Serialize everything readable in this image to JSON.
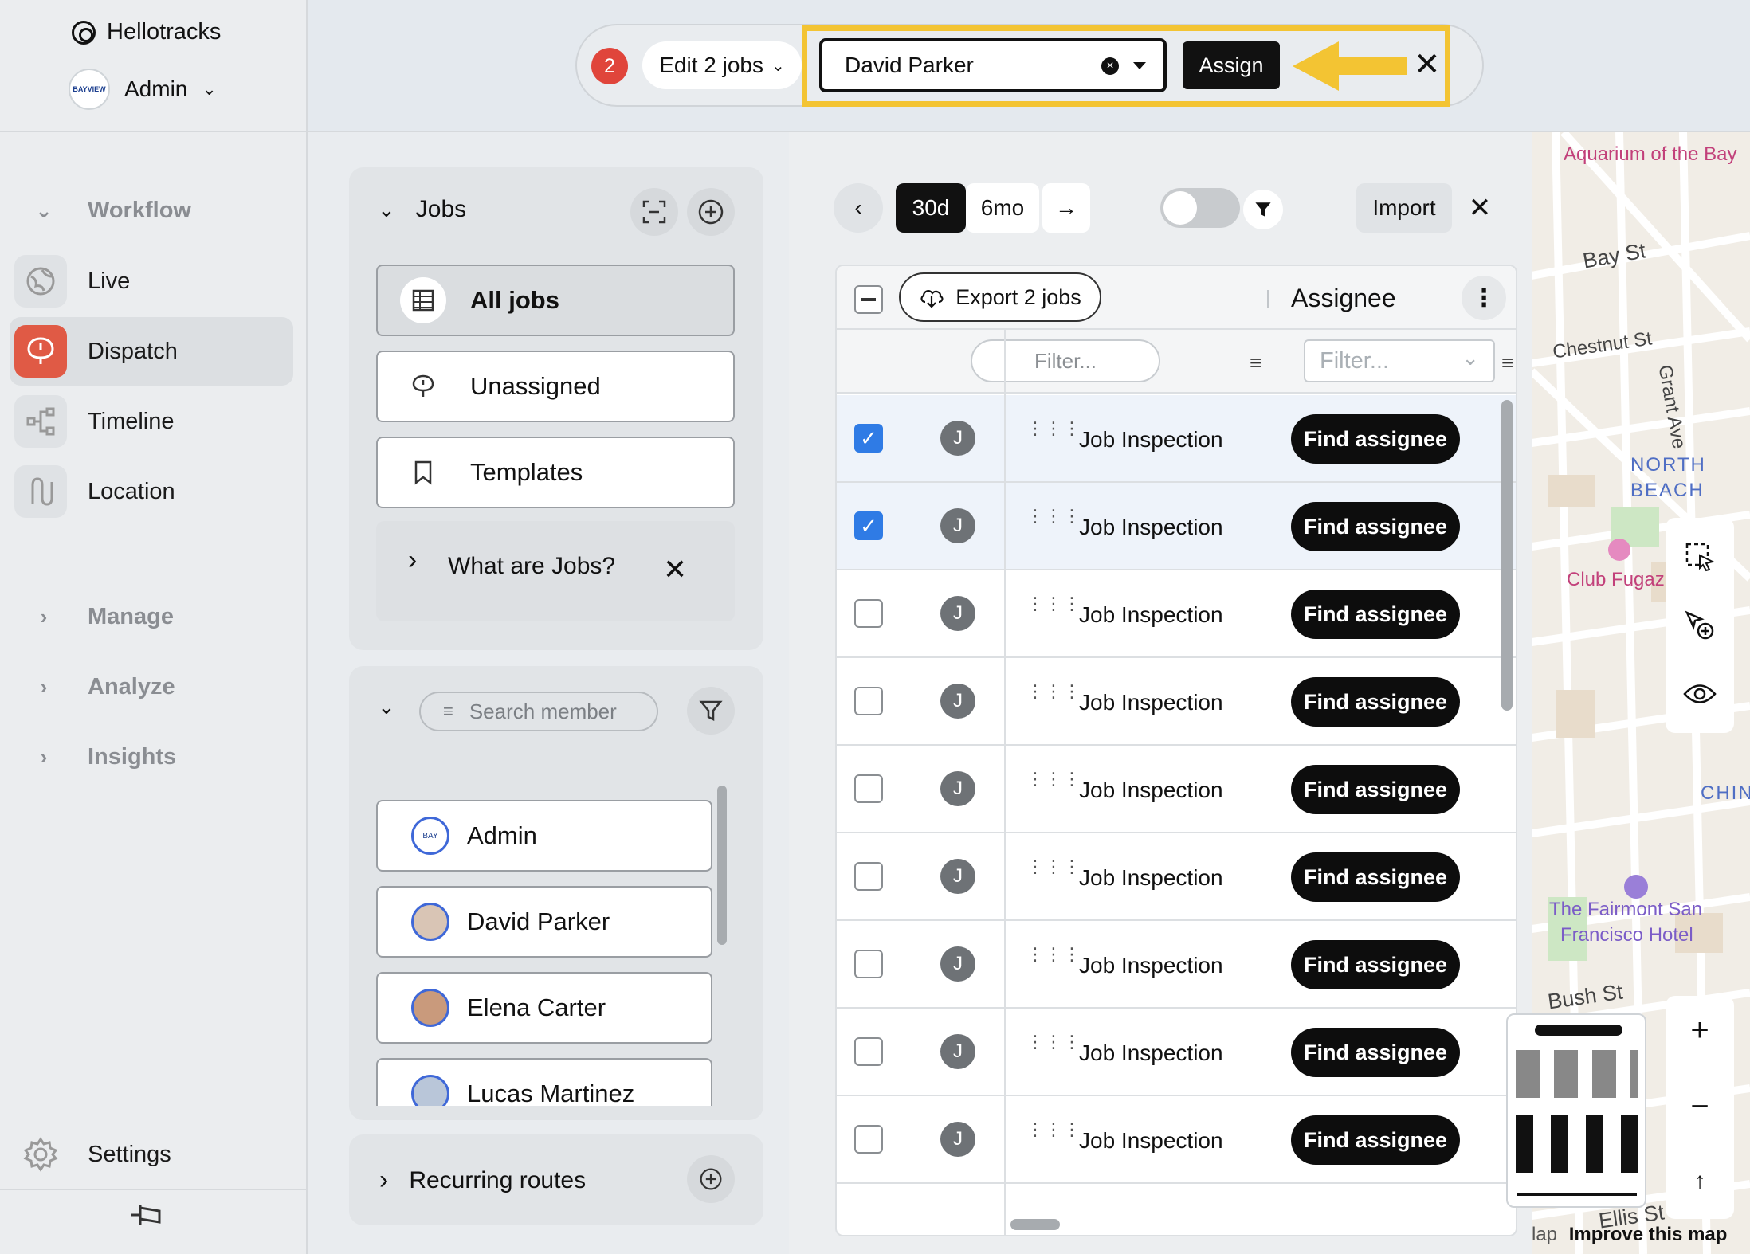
{
  "brand": {
    "name": "Hellotracks"
  },
  "org": {
    "name": "Admin",
    "logo_text": "BAYVIEW"
  },
  "sidebar": {
    "sections": {
      "workflow": "Workflow",
      "manage": "Manage",
      "analyze": "Analyze",
      "insights": "Insights"
    },
    "items": [
      {
        "label": "Live",
        "icon": "globe-icon"
      },
      {
        "label": "Dispatch",
        "icon": "dispatch-pin-icon",
        "active": true
      },
      {
        "label": "Timeline",
        "icon": "timeline-icon"
      },
      {
        "label": "Location",
        "icon": "route-icon"
      }
    ],
    "settings": "Settings"
  },
  "topbar": {
    "selected_count": "2",
    "edit_label": "Edit 2 jobs",
    "assignee_value": "David Parker",
    "assign_label": "Assign",
    "highlight_color": "#f3c433"
  },
  "jobs_panel": {
    "title": "Jobs",
    "nav": [
      {
        "label": "All jobs",
        "selected": true
      },
      {
        "label": "Unassigned"
      },
      {
        "label": "Templates"
      }
    ],
    "help": "What are Jobs?"
  },
  "members_panel": {
    "search_placeholder": "Search member",
    "members": [
      "Admin",
      "David Parker",
      "Elena Carter",
      "Lucas Martinez"
    ]
  },
  "recurring": {
    "label": "Recurring routes"
  },
  "controls": {
    "range_30d": "30d",
    "range_6mo": "6mo",
    "import_label": "Import"
  },
  "table": {
    "export_label": "Export 2 jobs",
    "assignee_header": "Assignee",
    "filter_placeholder_1": "Filter...",
    "filter_placeholder_2": "Filter...",
    "rows": [
      {
        "avatar": "J",
        "title": "Job Inspection",
        "action": "Find assignee",
        "checked": true
      },
      {
        "avatar": "J",
        "title": "Job Inspection",
        "action": "Find assignee",
        "checked": true
      },
      {
        "avatar": "J",
        "title": "Job Inspection",
        "action": "Find assignee",
        "checked": false
      },
      {
        "avatar": "J",
        "title": "Job Inspection",
        "action": "Find assignee",
        "checked": false
      },
      {
        "avatar": "J",
        "title": "Job Inspection",
        "action": "Find assignee",
        "checked": false
      },
      {
        "avatar": "J",
        "title": "Job Inspection",
        "action": "Find assignee",
        "checked": false
      },
      {
        "avatar": "J",
        "title": "Job Inspection",
        "action": "Find assignee",
        "checked": false
      },
      {
        "avatar": "J",
        "title": "Job Inspection",
        "action": "Find assignee",
        "checked": false
      },
      {
        "avatar": "J",
        "title": "Job Inspection",
        "action": "Find assignee",
        "checked": false
      }
    ]
  },
  "map": {
    "labels": {
      "aquarium": "Aquarium of the Bay",
      "bay_st": "Bay St",
      "chestnut_st": "Chestnut St",
      "grant_ave": "Grant Ave",
      "north": "NORTH",
      "beach": "BEACH",
      "club": "Club Fugaz",
      "chin": "CHIN",
      "fairmont_1": "The Fairmont San",
      "fairmont_2": "Francisco Hotel",
      "bush_st": "Bush St",
      "ellis_st": "Ellis St"
    },
    "footer_prefix": "lap",
    "footer_link": "Improve this map"
  }
}
